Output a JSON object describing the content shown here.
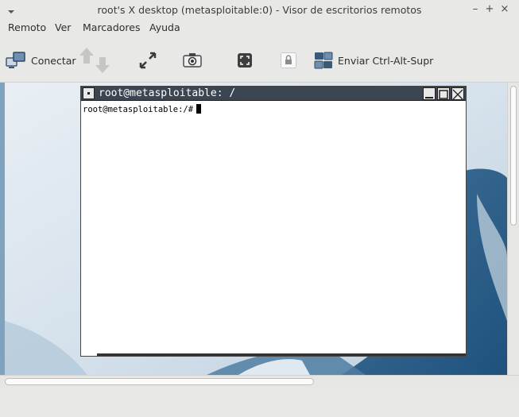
{
  "window": {
    "title": "root's X desktop (metasploitable:0) - Visor de escritorios remotos",
    "controls": [
      "–",
      "+",
      "×"
    ]
  },
  "menu": [
    "Remoto",
    "Ver",
    "Marcadores",
    "Ayuda"
  ],
  "toolbar": {
    "connect_label": "Conectar",
    "send_cad_label": "Enviar Ctrl-Alt-Supr"
  },
  "xterm": {
    "title": "root@metasploitable: /",
    "prompt": "root@metasploitable:/#"
  },
  "colors": {
    "accent": "#3b4652",
    "desktop": "#c9d9e6",
    "chrome": "#e8e8e7"
  }
}
